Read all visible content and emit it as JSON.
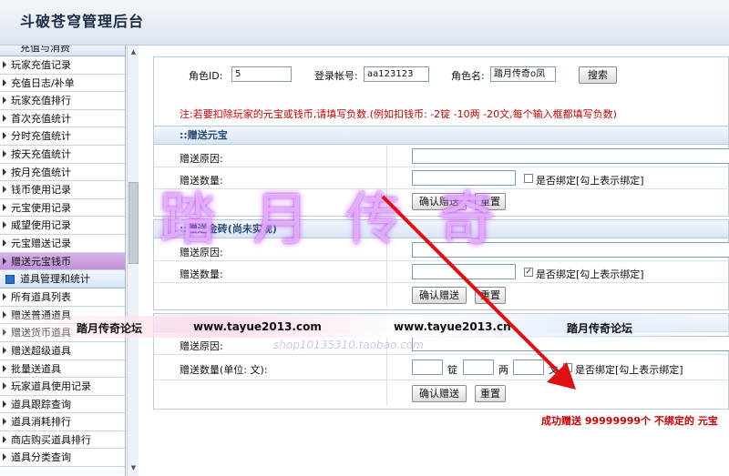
{
  "header": {
    "title": "斗破苍穹管理后台"
  },
  "sidebar": {
    "group_top": "充值与消费",
    "items": [
      "玩家充值记录",
      "充值日志/补单",
      "玩家充值排行",
      "首次充值统计",
      "分时充值统计",
      "按天充值统计",
      "按月充值统计",
      "钱币使用记录",
      "元宝使用记录",
      "威望使用记录",
      "元宝赠送记录",
      "赠送元宝钱币"
    ],
    "active_index": 11,
    "group2": "道具管理和统计",
    "items2": [
      "所有道具列表",
      "赠送普通道具",
      "赠送货币道具",
      "赠送超级道具",
      "批量送道具",
      "玩家道具使用记录",
      "道具跟踪查询",
      "道具消耗排行",
      "商店购买道具排行",
      "道具分类查询"
    ]
  },
  "search": {
    "role_id_label": "角色ID:",
    "role_id_value": "5",
    "account_label": "登录帐号:",
    "account_value": "aa123123",
    "role_name_label": "角色名:",
    "role_name_value": "踏月传奇o凤",
    "search_button": "搜索",
    "note": "注:若要扣除玩家的元宝或钱币,请填写负数.(例如扣钱币: -2锭 -10两 -20文,每个输入框都填写负数)"
  },
  "sections": {
    "yuanbao": {
      "title": "::赠送元宝",
      "reason_label": "赠送原因:",
      "amount_label": "赠送数量:",
      "bind_label": "是否绑定[勾上表示绑定]",
      "bind_checked": false,
      "confirm": "确认赠送",
      "reset": "重置"
    },
    "jinzhuan": {
      "title": "::赠送金砖(尚未实现)",
      "reason_label": "赠送原因:",
      "amount_label": "赠送数量:",
      "bind_label": "是否绑定[勾上表示绑定]",
      "bind_checked": true,
      "confirm": "确认赠送",
      "reset": "重置"
    },
    "money": {
      "reason_label": "赠送原因:",
      "amount_label": "赠送数量(单位: 文):",
      "unit_ding": "锭",
      "unit_liang": "两",
      "unit_wen": "文",
      "bind_label": "是否绑定[勾上表示绑定]",
      "confirm": "确认赠送",
      "reset": "重置"
    }
  },
  "success_message": "成功赠送 99999999个 不绑定的 元宝",
  "watermark": {
    "big": "踏月传奇",
    "band_left": "踏月传奇论坛",
    "band_url1": "www.tayue2013.com",
    "band_url2": "www.tayue2013.cn",
    "band_right": "踏月传奇论坛",
    "small": "shop10135310.taobao.com"
  },
  "colors": {
    "accent_red": "#cc0000",
    "sidebar_active": "#c08fd8",
    "section_head": "#2a4a7a",
    "arrow": "#e01010"
  }
}
